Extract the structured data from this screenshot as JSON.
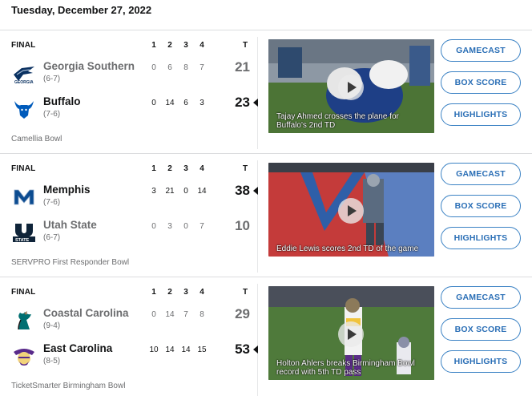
{
  "date": "Tuesday, December 27, 2022",
  "quarter_headers": [
    "1",
    "2",
    "3",
    "4"
  ],
  "total_header": "T",
  "buttons": {
    "gamecast": "GAMECAST",
    "box_score": "BOX SCORE",
    "highlights": "HIGHLIGHTS"
  },
  "games": [
    {
      "status": "FINAL",
      "bowl": "Camellia Bowl",
      "teams": [
        {
          "name": "Georgia Southern",
          "record": "(6-7)",
          "quarters": [
            "0",
            "6",
            "8",
            "7"
          ],
          "total": "21",
          "winner": false,
          "logo": "eagle-logo",
          "color": "#0a3161"
        },
        {
          "name": "Buffalo",
          "record": "(7-6)",
          "quarters": [
            "0",
            "14",
            "6",
            "3"
          ],
          "total": "23",
          "winner": true,
          "logo": "bull-logo",
          "color": "#005bbb"
        }
      ],
      "video_caption": "Tajay Ahmed crosses the plane for Buffalo's 2nd TD"
    },
    {
      "status": "FINAL",
      "bowl": "SERVPRO First Responder Bowl",
      "teams": [
        {
          "name": "Memphis",
          "record": "(7-6)",
          "quarters": [
            "3",
            "21",
            "0",
            "14"
          ],
          "total": "38",
          "winner": true,
          "logo": "memphis-m-logo",
          "color": "#0c4c91"
        },
        {
          "name": "Utah State",
          "record": "(6-7)",
          "quarters": [
            "0",
            "3",
            "0",
            "7"
          ],
          "total": "10",
          "winner": false,
          "logo": "utah-state-logo",
          "color": "#0f2439"
        }
      ],
      "video_caption": "Eddie Lewis scores 2nd TD of the game"
    },
    {
      "status": "FINAL",
      "bowl": "TicketSmarter Birmingham Bowl",
      "teams": [
        {
          "name": "Coastal Carolina",
          "record": "(9-4)",
          "quarters": [
            "0",
            "14",
            "7",
            "8"
          ],
          "total": "29",
          "winner": false,
          "logo": "chanticleer-logo",
          "color": "#006f71"
        },
        {
          "name": "East Carolina",
          "record": "(8-5)",
          "quarters": [
            "10",
            "14",
            "14",
            "15"
          ],
          "total": "53",
          "winner": true,
          "logo": "pirate-logo",
          "color": "#592a8a"
        }
      ],
      "video_caption": "Holton Ahlers breaks Birmingham Bowl record with 5th TD pass"
    }
  ]
}
